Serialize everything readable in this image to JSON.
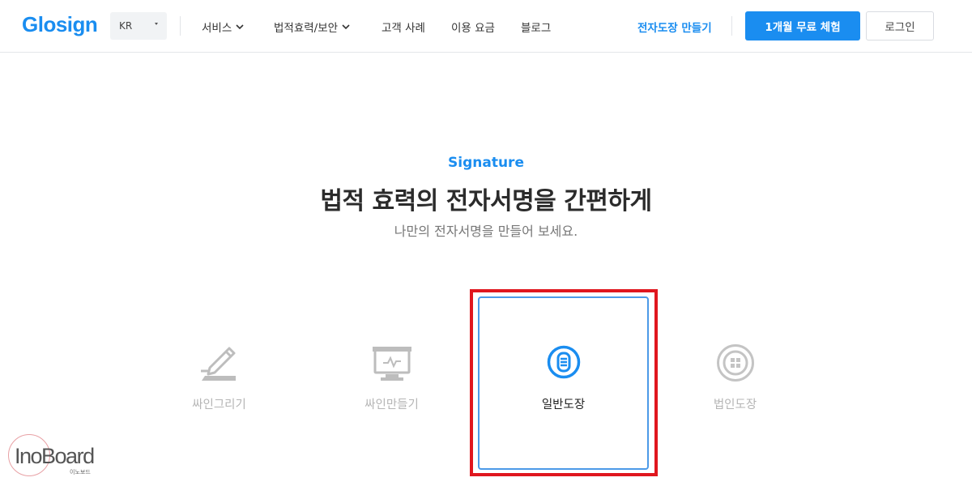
{
  "header": {
    "logo": "Glosign",
    "language": "KR",
    "nav": [
      {
        "label": "서비스",
        "has_dropdown": true
      },
      {
        "label": "법적효력/보안",
        "has_dropdown": true
      },
      {
        "label": "고객 사례",
        "has_dropdown": false
      },
      {
        "label": "이용 요금",
        "has_dropdown": false
      },
      {
        "label": "블로그",
        "has_dropdown": false
      }
    ],
    "cta_link": "전자도장 만들기",
    "trial_button": "1개월 무료 체험",
    "login_button": "로그인"
  },
  "hero": {
    "eyebrow": "Signature",
    "title": "법적 효력의 전자서명을 간편하게",
    "subtitle": "나만의 전자서명을 만들어 보세요."
  },
  "options": [
    {
      "label": "싸인그리기",
      "icon": "pen-sign-icon",
      "selected": false
    },
    {
      "label": "싸인만들기",
      "icon": "monitor-signature-icon",
      "selected": false
    },
    {
      "label": "일반도장",
      "icon": "stamp-round-icon",
      "selected": true
    },
    {
      "label": "법인도장",
      "icon": "stamp-corporate-icon",
      "selected": false
    }
  ],
  "colors": {
    "brand": "#1a8df0",
    "selected_border": "#4c9ae8",
    "annotation_box": "#e0161e",
    "inactive_icon": "#bdbdbd"
  },
  "watermark": {
    "text": "InoBoard",
    "sub": "이노보드"
  }
}
